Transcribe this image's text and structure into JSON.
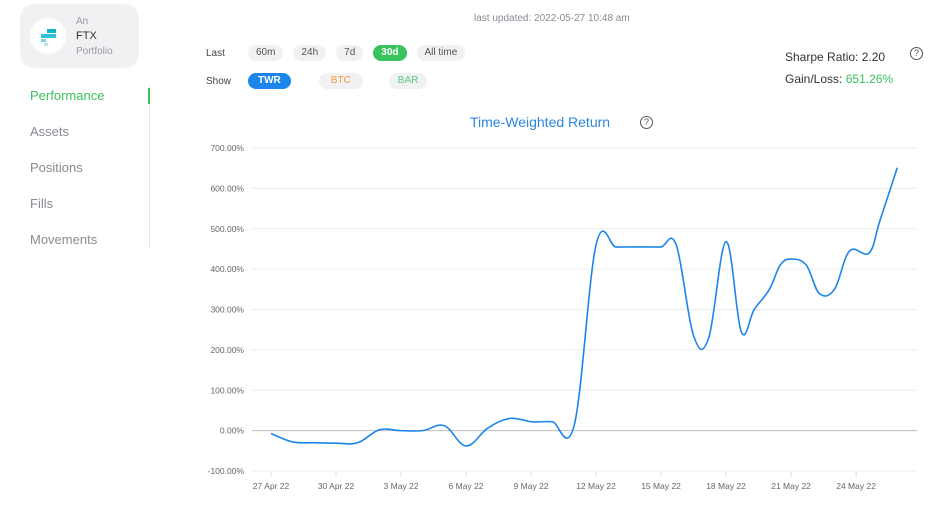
{
  "brand": {
    "prefix": "An",
    "name": "FTX",
    "suffix": "Portfolio",
    "logo_icon": "ftx-logo-icon"
  },
  "sidebar": {
    "items": [
      {
        "label": "Performance",
        "active": true
      },
      {
        "label": "Assets",
        "active": false
      },
      {
        "label": "Positions",
        "active": false
      },
      {
        "label": "Fills",
        "active": false
      },
      {
        "label": "Movements",
        "active": false
      }
    ]
  },
  "header": {
    "last_updated": "last updated: 2022-05-27 10:48 am"
  },
  "range": {
    "label": "Last",
    "options": [
      "60m",
      "24h",
      "7d",
      "30d",
      "All time"
    ],
    "selected": "30d"
  },
  "show": {
    "label": "Show",
    "options": [
      "TWR",
      "BTC",
      "BAR"
    ],
    "selected": "TWR"
  },
  "stats": {
    "sharpe_label": "Sharpe Ratio:",
    "sharpe_value": "2.20",
    "gain_label": "Gain/Loss:",
    "gain_value": "651.26%",
    "help_icon": "?"
  },
  "colors": {
    "accent_green": "#3ac25e",
    "accent_blue": "#1c85ec",
    "line": "#1c85ec",
    "btc": "#f59a3a",
    "bar": "#5ec97a"
  },
  "chart_data": {
    "type": "line",
    "title": "Time-Weighted Return",
    "xlabel": "",
    "ylabel": "",
    "ylim": [
      -100,
      700
    ],
    "y_ticks": [
      700,
      600,
      500,
      400,
      300,
      200,
      100,
      0,
      -100
    ],
    "y_tick_labels": [
      "700.00%",
      "600.00%",
      "500.00%",
      "400.00%",
      "300.00%",
      "200.00%",
      "100.00%",
      "0.00%",
      "-100.00%"
    ],
    "x_tick_labels": [
      "27 Apr 22",
      "30 Apr 22",
      "3 May 22",
      "6 May 22",
      "9 May 22",
      "12 May 22",
      "15 May 22",
      "18 May 22",
      "21 May 22",
      "24 May 22"
    ],
    "x_tick_days": [
      0,
      3,
      6,
      9,
      12,
      15,
      18,
      21,
      24,
      27
    ],
    "x_range_days": [
      0,
      29.5
    ],
    "grid": true,
    "series": [
      {
        "name": "TWR",
        "x_days": [
          0,
          1,
          2,
          3,
          4,
          5,
          6,
          7,
          8,
          9,
          10,
          11,
          12,
          12.5,
          13,
          14,
          15,
          15.9,
          16.5,
          17.3,
          18,
          18.7,
          19.5,
          20.2,
          21,
          21.7,
          22.3,
          23,
          23.5,
          24,
          24.7,
          25.3,
          26,
          26.7,
          27.6,
          28.1,
          28.9
        ],
        "values": [
          -7,
          -28,
          -30,
          -31,
          -30,
          2,
          0,
          0,
          12,
          -38,
          6,
          30,
          22,
          22,
          22,
          15,
          460,
          455,
          455,
          455,
          455,
          460,
          235,
          230,
          468,
          245,
          300,
          350,
          410,
          425,
          410,
          340,
          350,
          445,
          440,
          520,
          651
        ]
      }
    ]
  }
}
